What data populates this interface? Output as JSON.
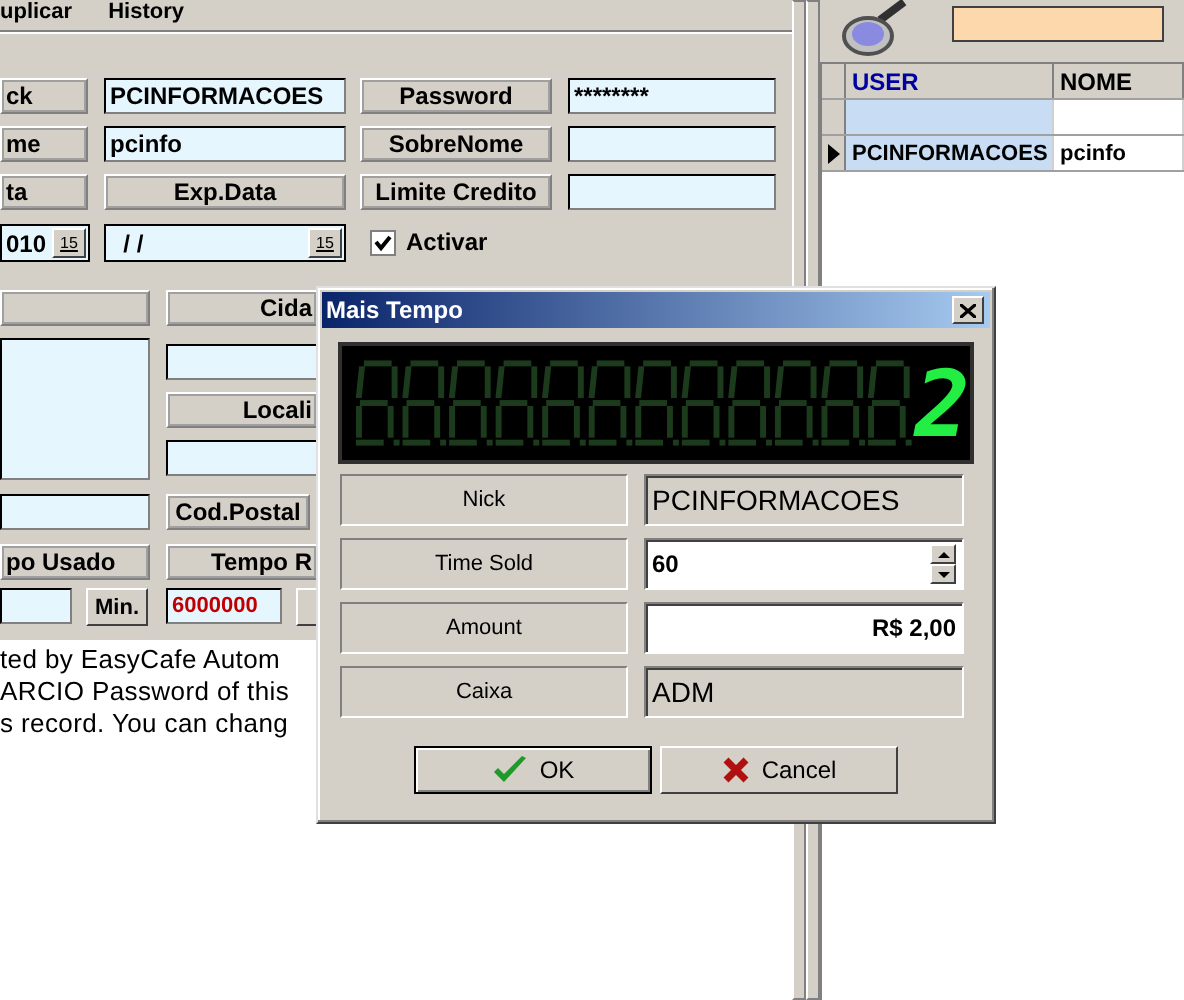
{
  "menu": [
    "uplicar",
    "History"
  ],
  "user_form": {
    "nick_label": "ck",
    "nick": "PCINFORMACOES",
    "password_label": "Password",
    "password": "********",
    "name_label": "me",
    "name": "pcinfo",
    "surname_label": "SobreNome",
    "date_label": "ta",
    "exp_date_label": "Exp.Data",
    "credit_label": "Limite Credito",
    "date": "010",
    "calendar_button": "15",
    "exp_date": "/ /",
    "exp_calendar_button": "15",
    "active": {
      "label": "Activar",
      "checked": true
    },
    "city_label": "Cida",
    "locality_label": "Locali",
    "postal_label": "Cod.Postal",
    "used_label": "po Usado",
    "remaining_label": "Tempo R",
    "minutes_button": "Min.",
    "remaining": "6000000"
  },
  "notes": [
    "ted by EasyCafe Autom",
    "ARCIO Password of this",
    "s record. You can chang"
  ],
  "user_grid": {
    "columns": [
      "USER",
      "NOME"
    ],
    "rows": [
      {
        "current": false
      },
      {
        "current": true,
        "user": "PCINFORMACOES",
        "nome": "pcinfo"
      }
    ]
  },
  "dialog": {
    "title": "Mais Tempo",
    "display": {
      "value": "2"
    },
    "rows": [
      {
        "label": "Nick",
        "value": "PCINFORMACOES",
        "kind": "readonly"
      },
      {
        "label": "Time Sold",
        "value": "60",
        "kind": "spin"
      },
      {
        "label": "Amount",
        "value": "R$ 2,00",
        "kind": "amount"
      },
      {
        "label": "Caixa",
        "value": "ADM",
        "kind": "readonly"
      }
    ],
    "buttons": [
      {
        "label": "OK",
        "kind": "ok"
      },
      {
        "label": "Cancel",
        "kind": "cancel"
      }
    ]
  }
}
